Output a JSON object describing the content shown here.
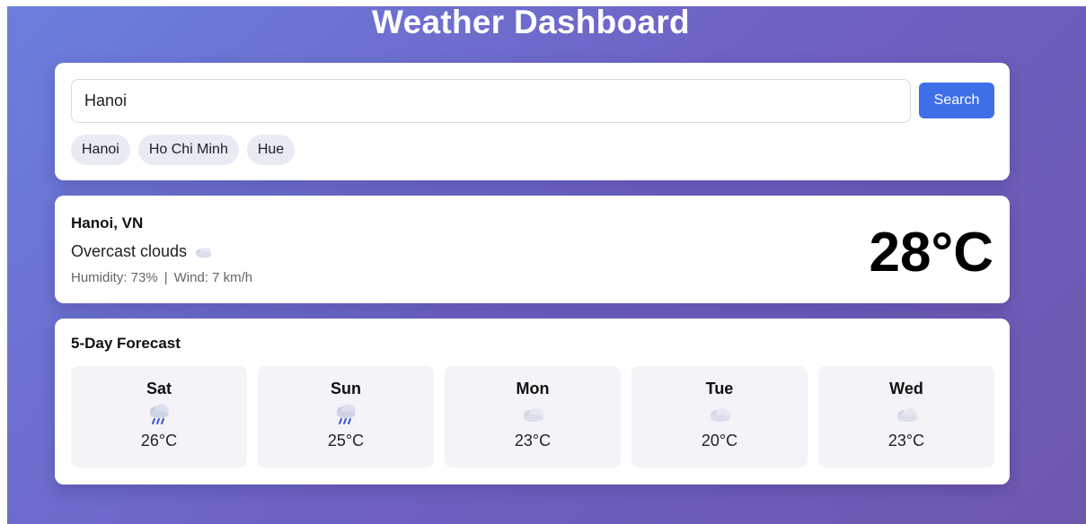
{
  "header": {
    "title": "Weather Dashboard"
  },
  "search": {
    "value": "Hanoi",
    "button_label": "Search",
    "chips": [
      "Hanoi",
      "Ho Chi Minh",
      "Hue"
    ]
  },
  "current": {
    "city": "Hanoi, VN",
    "condition": "Overcast clouds",
    "condition_icon": "cloud-icon",
    "humidity": "Humidity: 73%",
    "separator": "|",
    "wind": "Wind: 7 km/h",
    "temperature": "28°C"
  },
  "forecast": {
    "title": "5-Day Forecast",
    "days": [
      {
        "day": "Sat",
        "icon": "rain-cloud-icon",
        "temp": "26°C"
      },
      {
        "day": "Sun",
        "icon": "rain-cloud-icon",
        "temp": "25°C"
      },
      {
        "day": "Mon",
        "icon": "cloud-icon",
        "temp": "23°C"
      },
      {
        "day": "Tue",
        "icon": "cloud-icon",
        "temp": "20°C"
      },
      {
        "day": "Wed",
        "icon": "cloud-icon",
        "temp": "23°C"
      }
    ]
  },
  "colors": {
    "background_start": "#6c7fdc",
    "background_end": "#6f58ae",
    "accent": "#3f6fe8",
    "card": "#ffffff",
    "chip": "#e8eaf4",
    "forecast_tile": "#f3f3f8"
  }
}
